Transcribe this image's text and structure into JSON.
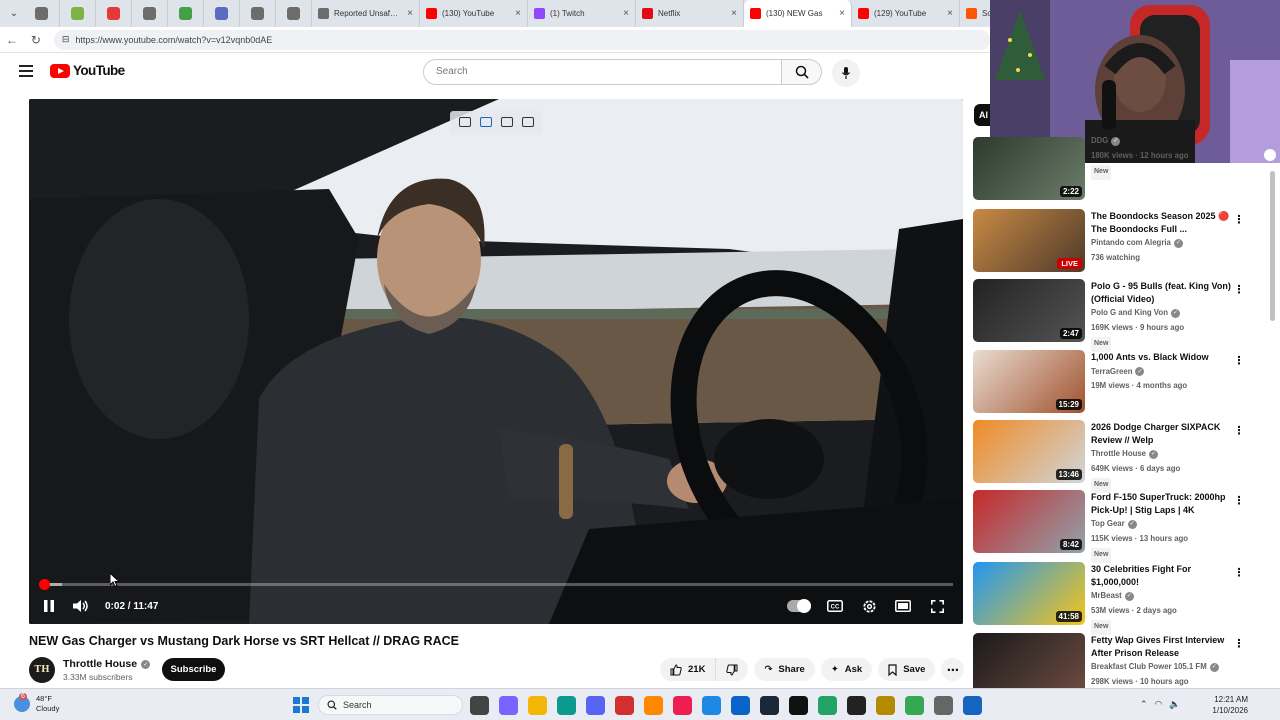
{
  "browser": {
    "pinned_tabs": [
      {
        "icon": "shield-icon",
        "color": "#6c6c6c"
      },
      {
        "icon": "android-icon",
        "color": "#7cb342"
      },
      {
        "icon": "bolt-icon",
        "color": "#e53935"
      },
      {
        "icon": "globe-icon",
        "color": "#6c6c6c"
      },
      {
        "icon": "play-icon",
        "color": "#43a047"
      },
      {
        "icon": "app-icon",
        "color": "#5c6bc0"
      },
      {
        "icon": "search-icon",
        "color": "#6c6c6c"
      },
      {
        "icon": "web-icon",
        "color": "#6c6c6c"
      }
    ],
    "tabs": [
      {
        "title": "Reported Unsafe Si",
        "color": "#6c6c6c",
        "active": false
      },
      {
        "title": "(130) YouTube",
        "color": "#ff0000",
        "active": false
      },
      {
        "title": "(1) Twitch",
        "color": "#9146ff",
        "active": false
      },
      {
        "title": "Netflix",
        "color": "#e50914",
        "active": false
      },
      {
        "title": "(130) NEW Gas",
        "color": "#ff0000",
        "active": true
      },
      {
        "title": "(129) YouTube",
        "color": "#ff0000",
        "active": false
      },
      {
        "title": "SoundCloud",
        "color": "#ff5500",
        "active": false
      }
    ],
    "url": "https://www.youtube.com/watch?v=v12vqnb0dAE"
  },
  "youtube": {
    "logo_text": "YouTube",
    "search_placeholder": "Search"
  },
  "player": {
    "time_current": "0:02",
    "time_total": "11:47",
    "time_label": "0:02 / 11:47",
    "progress_fraction": 0.003,
    "buffer_fraction": 0.025
  },
  "video": {
    "title": "NEW Gas Charger vs Mustang Dark Horse vs SRT Hellcat // DRAG RACE",
    "channel": "Throttle House",
    "channel_avatar_text": "TH",
    "subscribers": "3.33M subscribers",
    "subscribe_label": "Subscribe",
    "likes": "21K",
    "share_label": "Share",
    "ask_label": "Ask",
    "save_label": "Save"
  },
  "sidebar": {
    "chip_label": "Al",
    "recommendations": [
      {
        "title": "",
        "channel": "DDG",
        "meta": "180K views · 12 hours ago",
        "badge": "New",
        "duration": "2:22",
        "live": false,
        "colors": [
          "#2d3a2e",
          "#6c7d6a"
        ]
      },
      {
        "title": "The Boondocks Season 2025 🔴 The Boondocks Full ...",
        "channel": "Pintando com Alegria",
        "meta": "736 watching",
        "badge": "",
        "duration": "LIVE",
        "live": true,
        "colors": [
          "#c98a44",
          "#4e3a2a"
        ]
      },
      {
        "title": "Polo G - 95 Bulls (feat. King Von) (Official Video)",
        "channel": "Polo G and King Von",
        "meta": "169K views · 9 hours ago",
        "badge": "New",
        "duration": "2:47",
        "live": false,
        "colors": [
          "#222222",
          "#555555"
        ]
      },
      {
        "title": "1,000 Ants vs. Black Widow",
        "channel": "TerraGreen",
        "meta": "19M views · 4 months ago",
        "badge": "",
        "duration": "15:29",
        "live": false,
        "colors": [
          "#e8ddd2",
          "#a0522d"
        ]
      },
      {
        "title": "2026 Dodge Charger SIXPACK Review // Welp",
        "channel": "Throttle House",
        "meta": "649K views · 6 days ago",
        "badge": "New",
        "duration": "13:46",
        "live": false,
        "colors": [
          "#f08a24",
          "#cfd6dc"
        ]
      },
      {
        "title": "Ford F-150 SuperTruck: 2000hp Pick-Up! | Stig Laps | 4K",
        "channel": "Top Gear",
        "meta": "115K views · 13 hours ago",
        "badge": "New",
        "duration": "8:42",
        "live": false,
        "colors": [
          "#c62828",
          "#90a4ae"
        ]
      },
      {
        "title": "30 Celebrities Fight For $1,000,000!",
        "channel": "MrBeast",
        "meta": "53M views · 2 days ago",
        "badge": "New",
        "duration": "41:58",
        "live": false,
        "colors": [
          "#2196f3",
          "#f5c518"
        ]
      },
      {
        "title": "Fetty Wap Gives First Interview After Prison Release",
        "channel": "Breakfast Club Power 105.1 FM",
        "meta": "298K views · 10 hours ago",
        "badge": "",
        "duration": "",
        "live": false,
        "colors": [
          "#1a1a1a",
          "#6d4c41"
        ]
      }
    ]
  },
  "taskbar": {
    "weather_temp": "48°F",
    "weather_desc": "Cloudy",
    "weather_badge": "6",
    "search_label": "Search",
    "time": "12:21 AM",
    "date": "1/10/2026",
    "apps": [
      {
        "name": "file-explorer-icon",
        "color": "#444"
      },
      {
        "name": "copilot-icon",
        "color": "#7b61ff"
      },
      {
        "name": "folder-icon",
        "color": "#f2b705"
      },
      {
        "name": "edge-icon",
        "color": "#0c9a8e"
      },
      {
        "name": "discord-icon",
        "color": "#5865f2"
      },
      {
        "name": "app-icon",
        "color": "#d32f2f"
      },
      {
        "name": "vlc-icon",
        "color": "#ff8800"
      },
      {
        "name": "tiktok-icon",
        "color": "#ee1d52"
      },
      {
        "name": "store-icon",
        "color": "#1e88e5"
      },
      {
        "name": "outlook-icon",
        "color": "#0a64c8"
      },
      {
        "name": "steam-icon",
        "color": "#1b2838"
      },
      {
        "name": "tiktok2-icon",
        "color": "#111"
      },
      {
        "name": "excel-icon",
        "color": "#21a366"
      },
      {
        "name": "cod-icon",
        "color": "#222"
      },
      {
        "name": "game-icon",
        "color": "#b48a00"
      },
      {
        "name": "chrome-icon",
        "color": "#34a853"
      },
      {
        "name": "settings-icon",
        "color": "#666"
      },
      {
        "name": "defender-icon",
        "color": "#1565c0"
      }
    ]
  }
}
